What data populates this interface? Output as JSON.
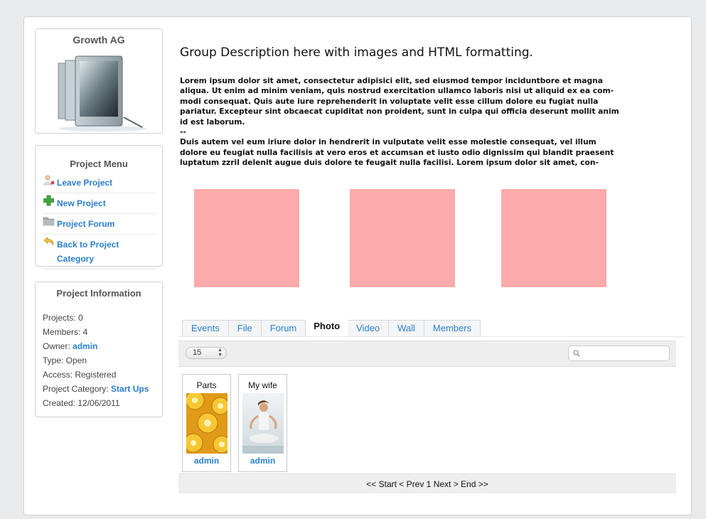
{
  "group": {
    "name": "Growth AG"
  },
  "project_menu": {
    "title": "Project Menu",
    "items": [
      {
        "label": "Leave Project",
        "icon": "leave-user-icon"
      },
      {
        "label": "New Project",
        "icon": "plus-icon"
      },
      {
        "label": "Project Forum",
        "icon": "folder-icon"
      },
      {
        "label": "Back to Project Category",
        "icon": "back-arrow-icon"
      }
    ]
  },
  "project_info": {
    "title": "Project Information",
    "projects_label": "Projects: 0",
    "members_label": "Members: 4",
    "owner_label": "Owner: ",
    "owner_value": "admin",
    "type_label": "Type: Open",
    "access_label": "Access: Registered",
    "category_label": "Project Category: ",
    "category_value": "Start Ups",
    "created_label": "Created: 12/06/2011"
  },
  "description": {
    "headline": "Group Description here with images and HTML formatting.",
    "lines": [
      "Lorem ipsum dolor sit amet, consectetur adipisici elit, sed eiusmod tempor inciduntbore et magna",
      "aliqua. Ut enim ad minim veniam, quis nostrud exercitation ullamco laboris nisi ut aliquid ex ea com-",
      "modi consequat. Quis aute iure reprehenderit in voluptate velit esse cillum dolore eu fugiat nulla",
      "pariatur. Excepteur sint obcaecat cupiditat non proident, sunt in culpa qui officia deserunt mollit anim",
      "id est laborum.",
      "--",
      "Duis autem vel eum iriure dolor in hendrerit in vulputate velit esse molestie consequat, vel illum",
      "dolore eu feugiat nulla facilisis at vero eros et accumsan et iusto odio dignissim qui blandit praesent",
      "luptatum zzril delenit augue duis dolore te feugait nulla facilisi. Lorem ipsum dolor sit amet, con-"
    ],
    "placeholder_color": "#fdaaaa"
  },
  "tabs": [
    {
      "label": "Events",
      "active": false
    },
    {
      "label": "File",
      "active": false
    },
    {
      "label": "Forum",
      "active": false
    },
    {
      "label": "Photo",
      "active": true
    },
    {
      "label": "Video",
      "active": false
    },
    {
      "label": "Wall",
      "active": false
    },
    {
      "label": "Members",
      "active": false
    }
  ],
  "toolbar": {
    "per_page": "15",
    "search_placeholder": ""
  },
  "photos": [
    {
      "title": "Parts",
      "owner": "admin",
      "thumb": "gears-image"
    },
    {
      "title": "My wife",
      "owner": "admin",
      "thumb": "yoga-woman-image"
    }
  ],
  "pager": {
    "start": "<< Start",
    "prev": "< Prev",
    "page": "1",
    "next": "Next >",
    "end": "End >>"
  },
  "colors": {
    "link": "#2a7fcf",
    "background": "#e9eaec"
  }
}
